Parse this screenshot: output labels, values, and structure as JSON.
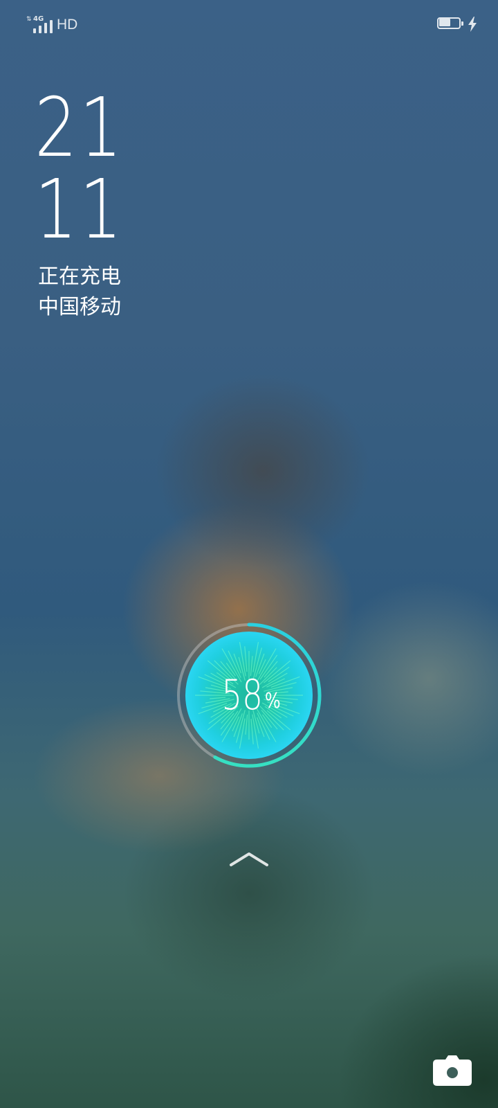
{
  "status_bar": {
    "network_type": "4G",
    "data_arrows": "⇅",
    "signal_bars": 4,
    "hd_label": "HD",
    "battery_level": 0.58,
    "charging_icon": "bolt-icon"
  },
  "lockscreen": {
    "clock_hour": "21",
    "clock_minute": "11",
    "charge_status": "正在充电",
    "carrier": "中国移动"
  },
  "charging": {
    "percent_value": "58",
    "percent_sign": "%",
    "level": 0.58,
    "ring_color": "#2fd3d6",
    "core_color": "#1ec6e8"
  },
  "icons": {
    "unlock": "chevron-up-icon",
    "camera": "camera-icon"
  }
}
